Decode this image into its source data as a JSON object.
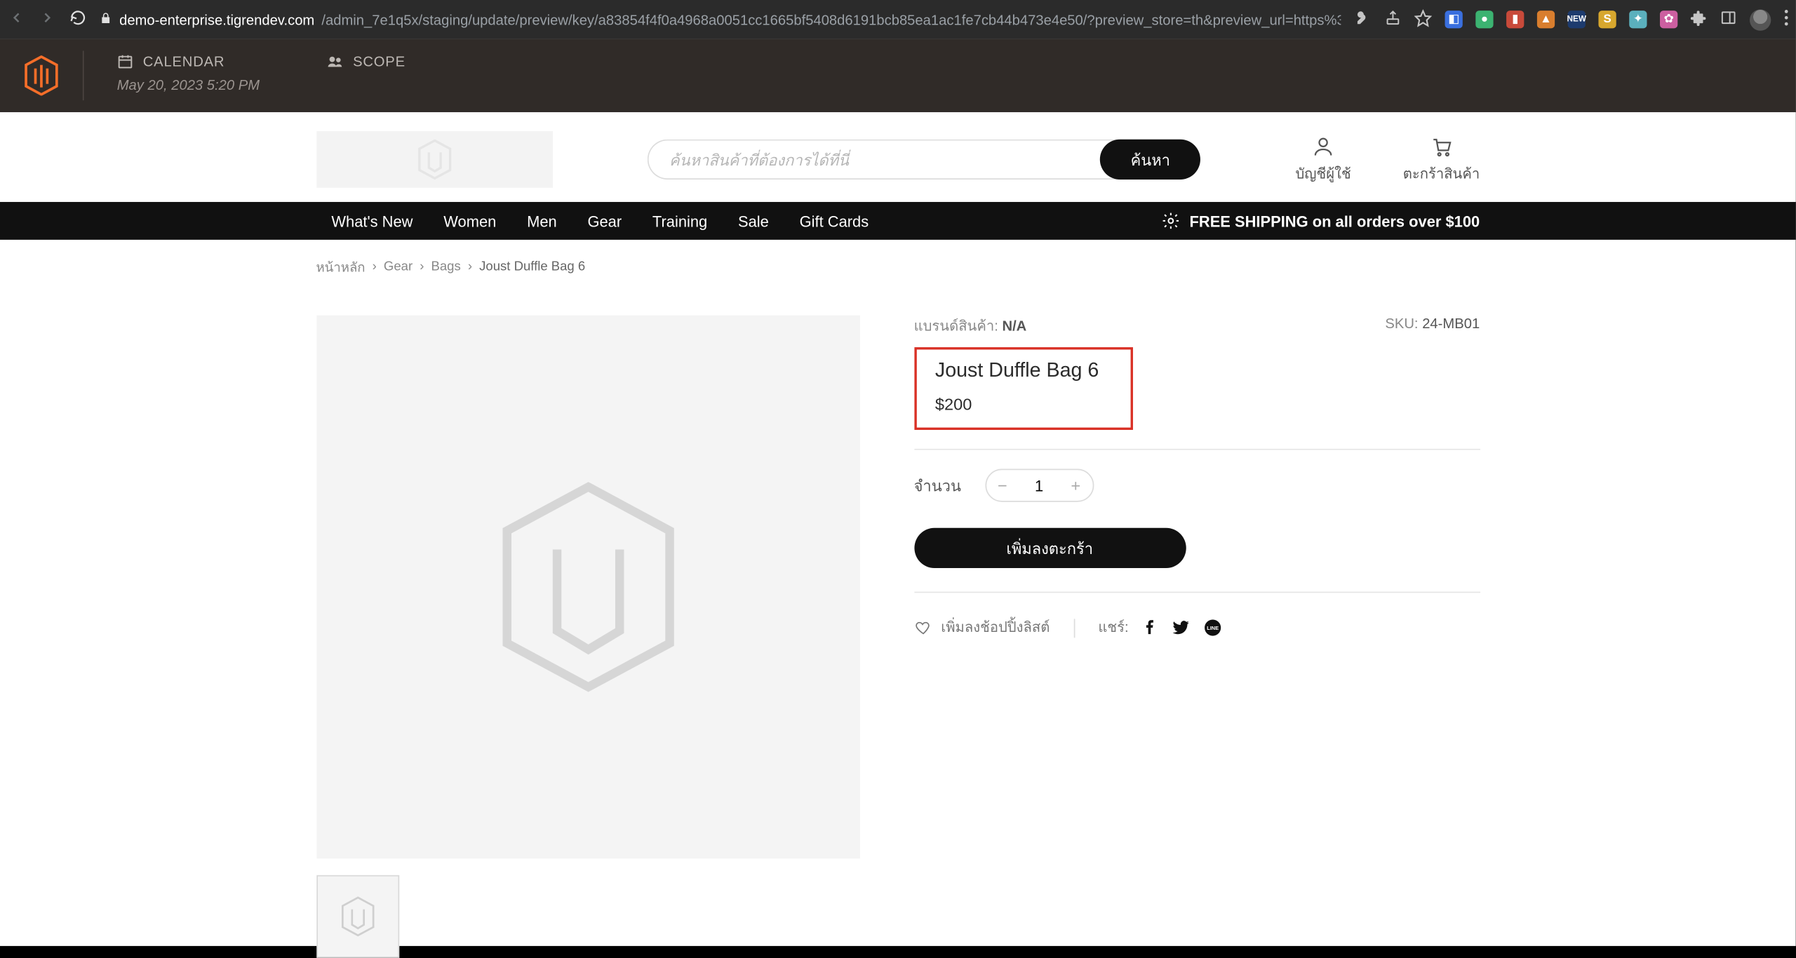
{
  "browser": {
    "url_domain": "demo-enterprise.tigrendev.com",
    "url_path": "/admin_7e1q5x/staging/update/preview/key/a83854f4f0a4968a0051cc1665bf5408d6191bcb85ea1ac1fe7cb44b473e4e50/?preview_store=th&preview_url=https%3..."
  },
  "adminbar": {
    "calendar_label": "CALENDAR",
    "calendar_value": "May 20, 2023 5:20 PM",
    "scope_label": "SCOPE"
  },
  "header": {
    "search_placeholder": "ค้นหาสินค้าที่ต้องการได้ที่นี่",
    "search_button": "ค้นหา",
    "account_label": "บัญชีผู้ใช้",
    "cart_label": "ตะกร้าสินค้า"
  },
  "nav": {
    "items": [
      "What's New",
      "Women",
      "Men",
      "Gear",
      "Training",
      "Sale",
      "Gift Cards"
    ],
    "promo": "FREE SHIPPING on all orders over $100"
  },
  "breadcrumbs": [
    "หน้าหลัก",
    "Gear",
    "Bags",
    "Joust Duffle Bag 6"
  ],
  "product": {
    "brand_label": "แบรนด์สินค้า:",
    "brand_value": "N/A",
    "sku_label": "SKU:",
    "sku_value": "24-MB01",
    "title": "Joust Duffle Bag 6",
    "price": "$200",
    "qty_label": "จำนวน",
    "qty_value": "1",
    "add_to_cart": "เพิ่มลงตะกร้า",
    "wishlist": "เพิ่มลงช้อปปิ้งลิสต์",
    "share_label": "แชร์:"
  }
}
